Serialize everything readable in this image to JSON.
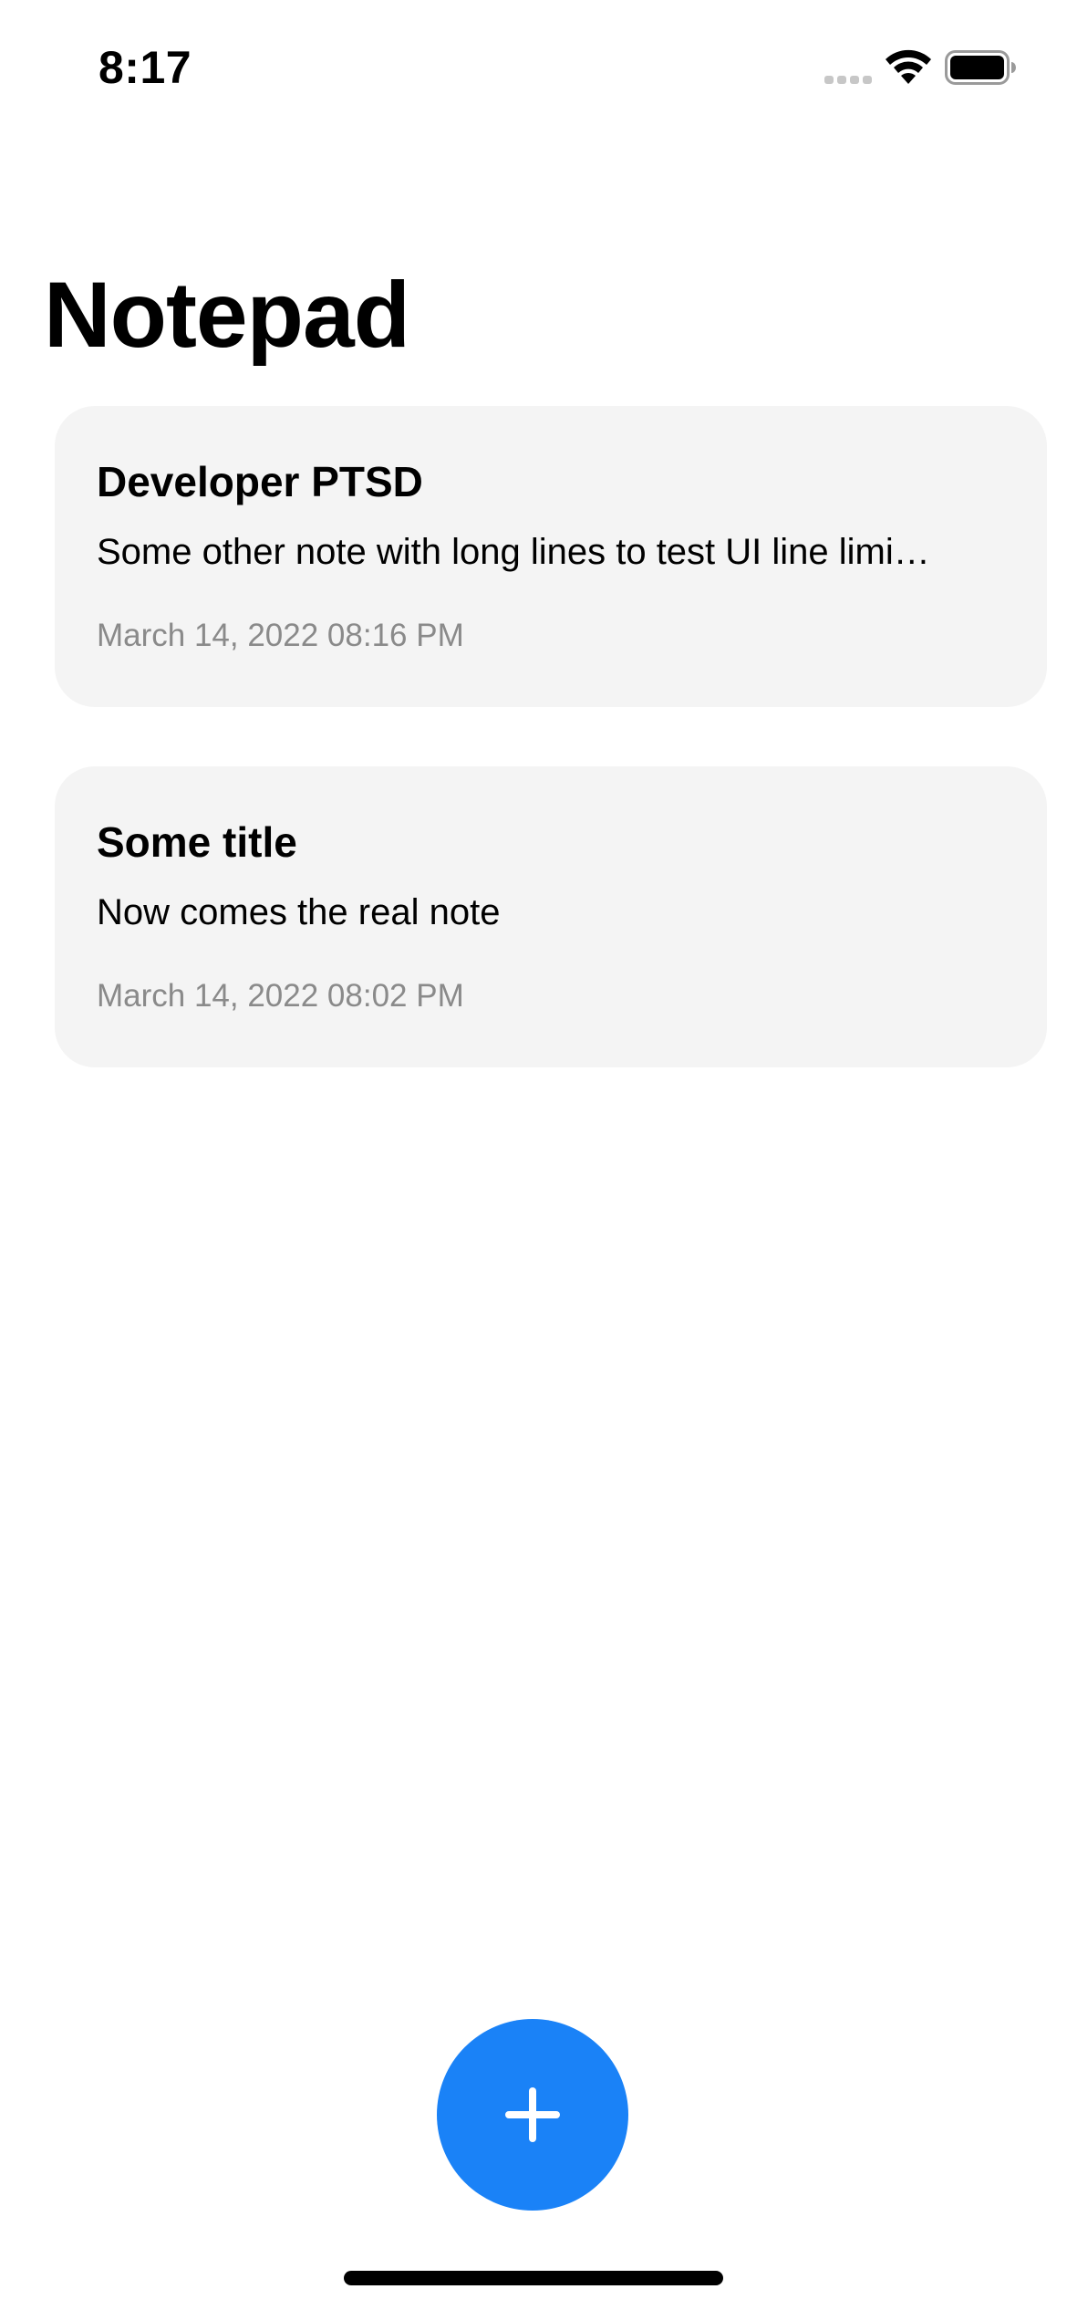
{
  "status_bar": {
    "time": "8:17",
    "icons": [
      "signal-icon",
      "wifi-icon",
      "battery-icon"
    ]
  },
  "header": {
    "title": "Notepad"
  },
  "notes": [
    {
      "title": "Developer PTSD",
      "body": "Some other note with long lines to test UI line limi…",
      "date": "March 14, 2022 08:16 PM"
    },
    {
      "title": "Some title",
      "body": "Now comes the real note",
      "date": "March 14, 2022 08:02 PM"
    }
  ],
  "add_button": {
    "icon": "plus-icon"
  },
  "colors": {
    "accent": "#1a82f7",
    "card_background": "#f4f4f4",
    "secondary_text": "#8a8a8a"
  }
}
